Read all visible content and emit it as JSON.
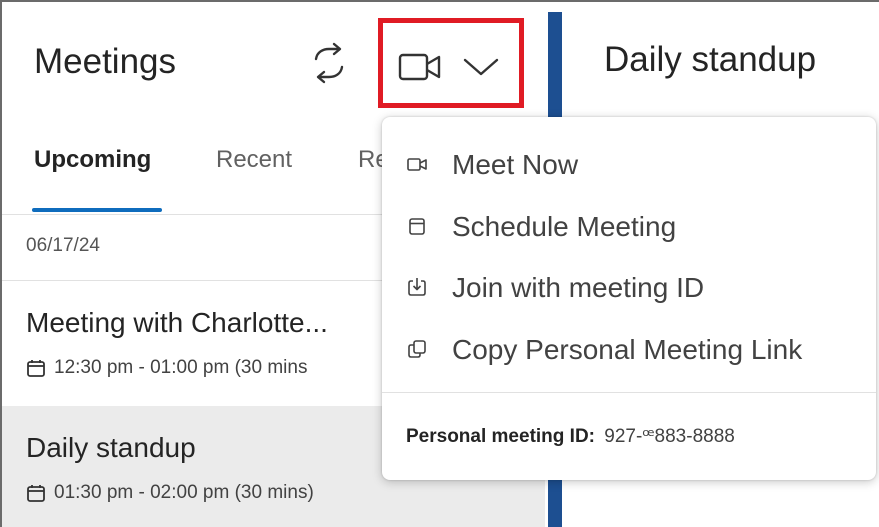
{
  "left_panel": {
    "title": "Meetings",
    "tabs": [
      {
        "label": "Upcoming",
        "active": true
      },
      {
        "label": "Recent",
        "active": false
      },
      {
        "label": "Re",
        "active": false
      }
    ],
    "date_group": "06/17/24",
    "meetings": [
      {
        "title": "Meeting with Charlotte...",
        "time": "12:30 pm - 01:00 pm (30 mins",
        "icon": "calendar-icon"
      },
      {
        "title": "Daily standup",
        "time": "01:30 pm - 02:00 pm (30 mins)",
        "icon": "calendar-icon"
      }
    ]
  },
  "toolbar": {
    "sync_icon": "sync-icon",
    "video_icon": "video-camera-icon",
    "chevron_icon": "chevron-down-icon",
    "highlight_color": "#e01b24"
  },
  "detail_panel": {
    "title": "Daily standup",
    "accent_color": "#1d4f91"
  },
  "dropdown_menu": {
    "items": [
      {
        "label": "Meet Now",
        "icon": "video-camera-icon"
      },
      {
        "label": "Schedule Meeting",
        "icon": "calendar-icon"
      },
      {
        "label": "Join with meeting ID",
        "icon": "join-icon"
      },
      {
        "label": "Copy Personal Meeting Link",
        "icon": "copy-link-icon"
      }
    ],
    "personal_meeting_id_label": "Personal meeting ID:",
    "personal_meeting_id_value": "927-ꟹ883-8888"
  }
}
